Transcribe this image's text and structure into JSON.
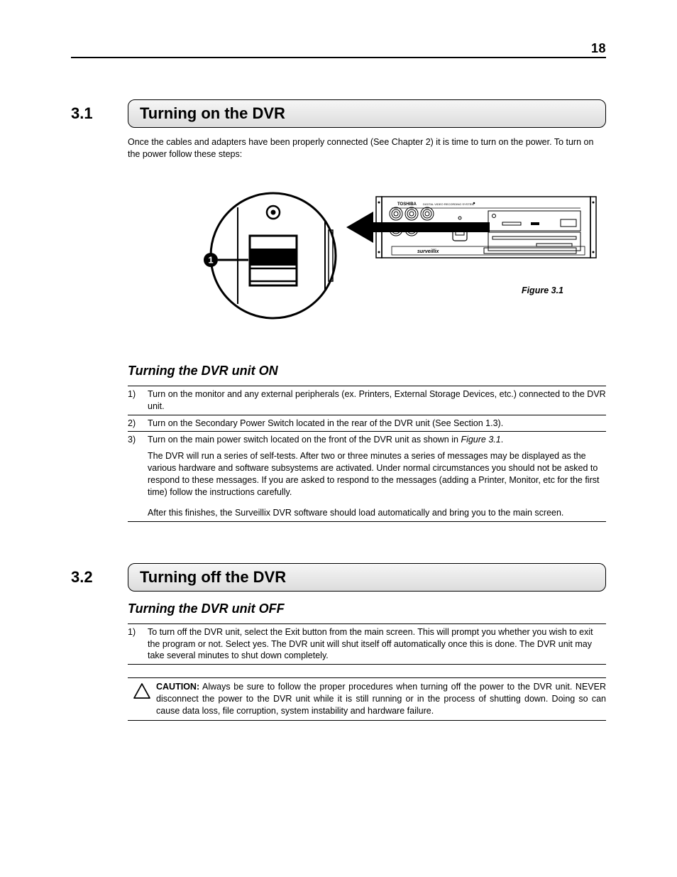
{
  "page_number": "18",
  "section_3_1": {
    "number": "3.1",
    "title": "Turning on the DVR",
    "intro": "Once the cables and adapters have been properly connected (See Chapter 2) it is time to turn on the power. To turn on the power follow these steps:",
    "figure_caption": "Figure 3.1",
    "subheading": "Turning the DVR unit ON",
    "steps": {
      "s1_num": "1)",
      "s1_text": "Turn on the monitor and any external peripherals (ex. Printers, External Storage Devices, etc.) connected to the DVR unit.",
      "s2_num": "2)",
      "s2_text": "Turn on the Secondary Power Switch located in the rear of the DVR unit (See Section 1.3).",
      "s3_num": "3)",
      "s3_text_a": "Turn on the main power switch located on the front of the DVR unit as shown in ",
      "s3_fig": "Figure 3.1",
      "s3_text_b": ".",
      "s3_text_c": "The DVR will run a series of self-tests. After two or three minutes a series of messages may be displayed as the various hardware and software subsystems are activated. Under normal circumstances you should not be asked to respond to these messages. If you are asked to respond to the messages (adding a Printer, Monitor, etc for the first time) follow the instructions carefully.",
      "s3_text_d": "After this finishes, the Surveillix DVR software should load automatically and bring you to the main screen."
    }
  },
  "section_3_2": {
    "number": "3.2",
    "title": "Turning off the DVR",
    "subheading": "Turning the DVR unit OFF",
    "steps": {
      "s1_num": "1)",
      "s1_text": "To turn off the DVR unit, select the Exit button from the main screen. This will prompt you whether you wish to exit the program or not. Select yes. The DVR unit will shut itself off automatically once this is done. The DVR unit may take several minutes to shut down completely."
    },
    "caution_label": "CAUTION:",
    "caution_text": " Always be sure to follow the proper procedures when turning off the power to the DVR unit. NEVER disconnect the power to the DVR unit while it is still running or in the process of shutting down. Doing so can cause data loss, file corruption, system instability and hardware failure."
  }
}
